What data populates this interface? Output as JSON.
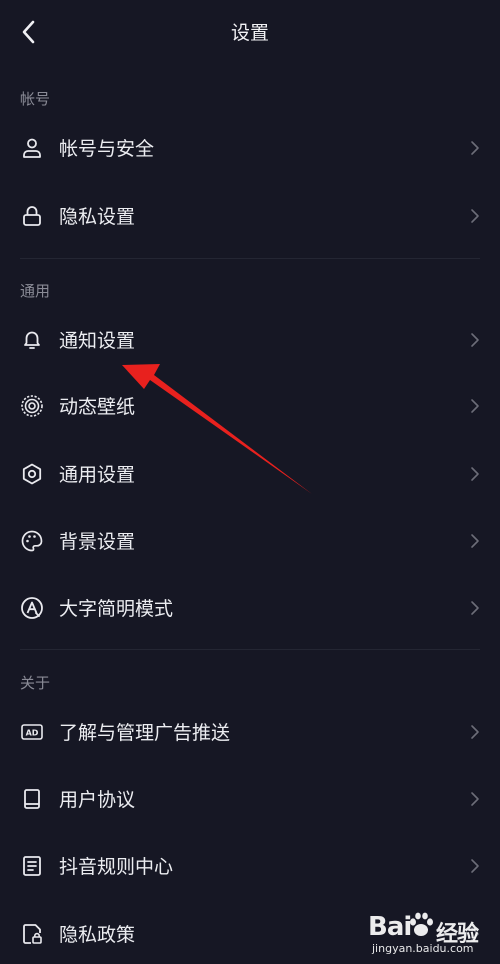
{
  "header": {
    "title": "设置",
    "back_icon": "chevron-left-icon"
  },
  "sections": {
    "account": {
      "title": "帐号",
      "items": [
        {
          "label": "帐号与安全",
          "icon": "user-icon"
        },
        {
          "label": "隐私设置",
          "icon": "lock-icon"
        }
      ]
    },
    "general": {
      "title": "通用",
      "items": [
        {
          "label": "通知设置",
          "icon": "bell-icon"
        },
        {
          "label": "动态壁纸",
          "icon": "live-wallpaper-icon"
        },
        {
          "label": "通用设置",
          "icon": "gear-icon"
        },
        {
          "label": "背景设置",
          "icon": "palette-icon"
        },
        {
          "label": "大字简明模式",
          "icon": "large-text-icon"
        }
      ]
    },
    "about": {
      "title": "关于",
      "items": [
        {
          "label": "了解与管理广告推送",
          "icon": "ad-icon"
        },
        {
          "label": "用户协议",
          "icon": "book-icon"
        },
        {
          "label": "抖音规则中心",
          "icon": "document-icon"
        },
        {
          "label": "隐私政策",
          "icon": "privacy-doc-icon"
        }
      ]
    }
  },
  "annotation": {
    "color": "#e8211e"
  },
  "watermark": {
    "brand": "Bai",
    "brand_cn": "经验",
    "url": "jingyan.baidu.com"
  },
  "colors": {
    "background": "#161724",
    "text": "#ecedf1",
    "muted": "#8a8b96"
  }
}
